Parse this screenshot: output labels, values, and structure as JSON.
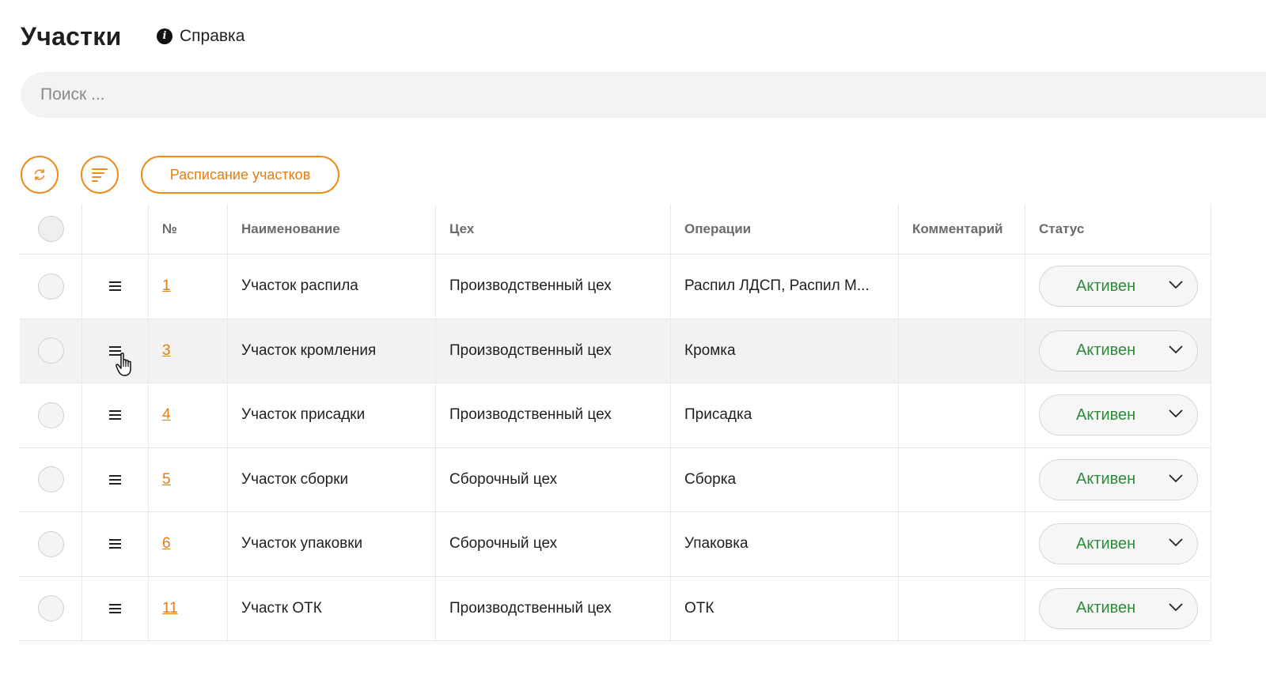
{
  "header": {
    "title": "Участки",
    "help_label": "Справка",
    "help_icon": "info-icon"
  },
  "search": {
    "placeholder": "Поиск ...",
    "value": ""
  },
  "toolbar": {
    "refresh_icon": "refresh-icon",
    "sort_icon": "sort-icon",
    "schedule_label": "Расписание участков",
    "accent": "#ef8a1f"
  },
  "table": {
    "columns": {
      "num": "№",
      "name": "Наименование",
      "shop": "Цех",
      "operations": "Операции",
      "comment": "Комментарий",
      "status": "Статус"
    },
    "rows": [
      {
        "num": "1",
        "name": "Участок распила",
        "shop": "Производственный цех",
        "operations": "Распил ЛДСП, Распил М...",
        "comment": "",
        "status": "Активен"
      },
      {
        "num": "3",
        "name": "Участок кромления",
        "shop": "Производственный цех",
        "operations": "Кромка",
        "comment": "",
        "status": "Активен"
      },
      {
        "num": "4",
        "name": "Участок присадки",
        "shop": "Производственный цех",
        "operations": "Присадка",
        "comment": "",
        "status": "Активен"
      },
      {
        "num": "5",
        "name": "Участок сборки",
        "shop": "Сборочный цех",
        "operations": "Сборка",
        "comment": "",
        "status": "Активен"
      },
      {
        "num": "6",
        "name": "Участок упаковки",
        "shop": "Сборочный цех",
        "operations": "Упаковка",
        "comment": "",
        "status": "Активен"
      },
      {
        "num": "11",
        "name": "Участк ОТК",
        "shop": "Производственный цех",
        "operations": "ОТК",
        "comment": "",
        "status": "Активен"
      }
    ],
    "status_color": "#2e8b3a"
  }
}
